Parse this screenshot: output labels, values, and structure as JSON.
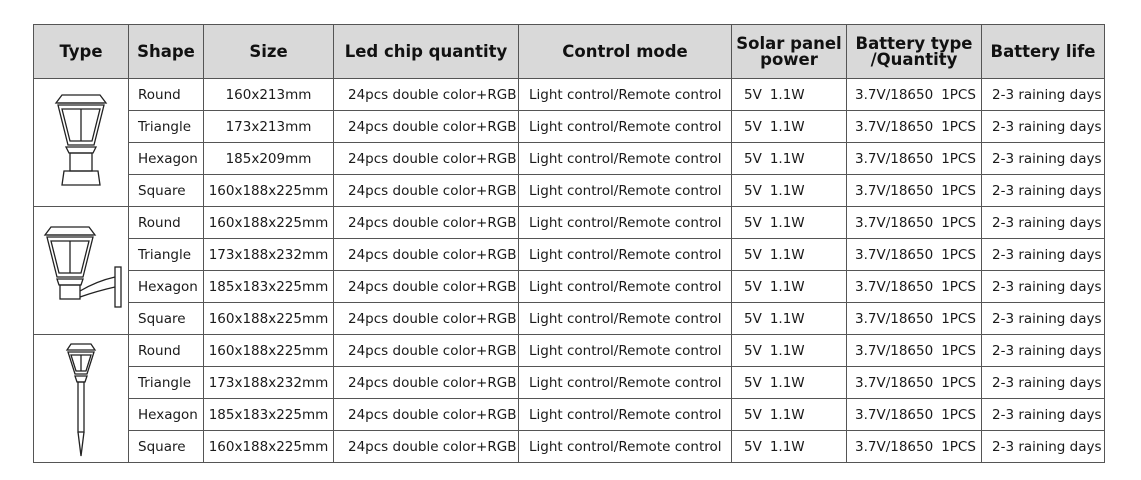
{
  "headers": {
    "type": "Type",
    "shape": "Shape",
    "size": "Size",
    "led": "Led chip quantity",
    "control": "Control mode",
    "solar_line1": "Solar panel",
    "solar_line2": "power",
    "battery_line1": "Battery type",
    "battery_line2": "/Quantity",
    "life": "Battery life"
  },
  "groups": [
    {
      "icon": "post-lamp-icon",
      "rows": [
        {
          "shape": "Round",
          "size": "160x213mm",
          "led": "24pcs double color+RGB",
          "control": "Light control/Remote control",
          "voltage": "5V",
          "watt": "1.1W",
          "battery": "3.7V/18650",
          "qty": "1PCS",
          "life": "2-3 raining days"
        },
        {
          "shape": "Triangle",
          "size": "173x213mm",
          "led": "24pcs double color+RGB",
          "control": "Light control/Remote control",
          "voltage": "5V",
          "watt": "1.1W",
          "battery": "3.7V/18650",
          "qty": "1PCS",
          "life": "2-3 raining days"
        },
        {
          "shape": "Hexagon",
          "size": "185x209mm",
          "led": "24pcs double color+RGB",
          "control": "Light control/Remote control",
          "voltage": "5V",
          "watt": "1.1W",
          "battery": "3.7V/18650",
          "qty": "1PCS",
          "life": "2-3 raining days"
        },
        {
          "shape": "Square",
          "size": "160x188x225mm",
          "led": "24pcs double color+RGB",
          "control": "Light control/Remote control",
          "voltage": "5V",
          "watt": "1.1W",
          "battery": "3.7V/18650",
          "qty": "1PCS",
          "life": "2-3 raining days"
        }
      ]
    },
    {
      "icon": "wall-lamp-icon",
      "rows": [
        {
          "shape": "Round",
          "size": "160x188x225mm",
          "led": "24pcs double color+RGB",
          "control": "Light control/Remote control",
          "voltage": "5V",
          "watt": "1.1W",
          "battery": "3.7V/18650",
          "qty": "1PCS",
          "life": "2-3 raining days"
        },
        {
          "shape": "Triangle",
          "size": "173x188x232mm",
          "led": "24pcs double color+RGB",
          "control": "Light control/Remote control",
          "voltage": "5V",
          "watt": "1.1W",
          "battery": "3.7V/18650",
          "qty": "1PCS",
          "life": "2-3 raining days"
        },
        {
          "shape": "Hexagon",
          "size": "185x183x225mm",
          "led": "24pcs double color+RGB",
          "control": "Light control/Remote control",
          "voltage": "5V",
          "watt": "1.1W",
          "battery": "3.7V/18650",
          "qty": "1PCS",
          "life": "2-3 raining days"
        },
        {
          "shape": "Square",
          "size": "160x188x225mm",
          "led": "24pcs double color+RGB",
          "control": "Light control/Remote control",
          "voltage": "5V",
          "watt": "1.1W",
          "battery": "3.7V/18650",
          "qty": "1PCS",
          "life": "2-3 raining days"
        }
      ]
    },
    {
      "icon": "stake-lamp-icon",
      "rows": [
        {
          "shape": "Round",
          "size": "160x188x225mm",
          "led": "24pcs double color+RGB",
          "control": "Light control/Remote control",
          "voltage": "5V",
          "watt": "1.1W",
          "battery": "3.7V/18650",
          "qty": "1PCS",
          "life": "2-3 raining days"
        },
        {
          "shape": "Triangle",
          "size": "173x188x232mm",
          "led": "24pcs double color+RGB",
          "control": "Light control/Remote control",
          "voltage": "5V",
          "watt": "1.1W",
          "battery": "3.7V/18650",
          "qty": "1PCS",
          "life": "2-3 raining days"
        },
        {
          "shape": "Hexagon",
          "size": "185x183x225mm",
          "led": "24pcs double color+RGB",
          "control": "Light control/Remote control",
          "voltage": "5V",
          "watt": "1.1W",
          "battery": "3.7V/18650",
          "qty": "1PCS",
          "life": "2-3 raining days"
        },
        {
          "shape": "Square",
          "size": "160x188x225mm",
          "led": "24pcs double color+RGB",
          "control": "Light control/Remote control",
          "voltage": "5V",
          "watt": "1.1W",
          "battery": "3.7V/18650",
          "qty": "1PCS",
          "life": "2-3 raining days"
        }
      ]
    }
  ],
  "colors": {
    "header_bg": "#d9d9d9",
    "border": "#555555"
  }
}
